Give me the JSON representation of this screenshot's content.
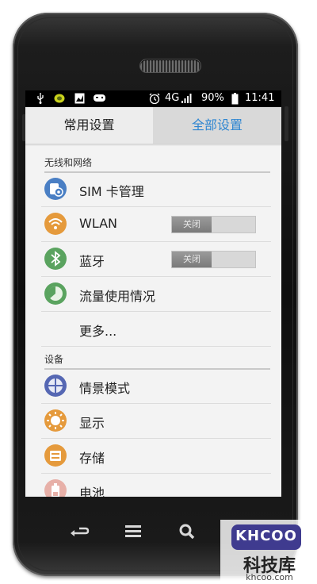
{
  "statusbar": {
    "network": "4G",
    "battery": "90%",
    "time": "11:41"
  },
  "tabs": [
    {
      "label": "常用设置"
    },
    {
      "label": "全部设置"
    }
  ],
  "sections": {
    "wireless": "无线和网络",
    "device": "设备"
  },
  "items": {
    "sim": "SIM 卡管理",
    "wlan": "WLAN",
    "bluetooth": "蓝牙",
    "data_usage": "流量使用情况",
    "more": "更多...",
    "profiles": "情景模式",
    "display": "显示",
    "storage": "存储",
    "battery": "电池"
  },
  "toggles": {
    "wlan": "关闭",
    "bluetooth": "关闭"
  },
  "watermark": {
    "logo": "KHCOO",
    "name": "科技库",
    "url": "khcoo.com"
  },
  "colors": {
    "accent": "#2f86d1",
    "icon_blue": "#4a7fc4",
    "icon_orange": "#e59a3c",
    "icon_green": "#5aa35f",
    "icon_purple": "#5567b3",
    "icon_pink": "#e7b0a8"
  },
  "icons": [
    "usb-icon",
    "notification-icon",
    "screenshot-icon",
    "game-icon",
    "alarm-icon",
    "signal-icon",
    "battery-icon",
    "sim-icon",
    "wifi-icon",
    "bluetooth-icon",
    "data-usage-icon",
    "profile-icon",
    "display-icon",
    "storage-icon",
    "battery-item-icon",
    "back-icon",
    "menu-icon",
    "search-icon"
  ]
}
